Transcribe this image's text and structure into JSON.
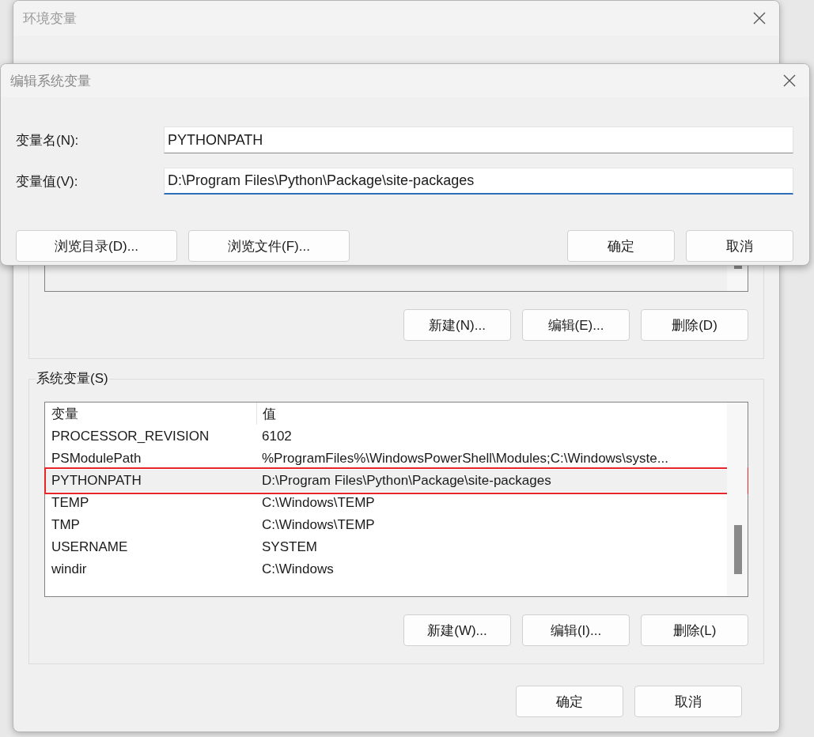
{
  "background_window": {
    "title": "环境变量",
    "user_variables": {
      "buttons": [
        "新建(N)...",
        "编辑(E)...",
        "删除(D)"
      ]
    },
    "system_variables": {
      "label": "系统变量(S)",
      "columns": [
        "变量",
        "值"
      ],
      "rows": [
        {
          "name": "PROCESSOR_REVISION",
          "value": "6102",
          "selected": false,
          "annotated": false
        },
        {
          "name": "PSModulePath",
          "value": "%ProgramFiles%\\WindowsPowerShell\\Modules;C:\\Windows\\syste...",
          "selected": false,
          "annotated": false
        },
        {
          "name": "PYTHONPATH",
          "value": "D:\\Program Files\\Python\\Package\\site-packages",
          "selected": true,
          "annotated": true
        },
        {
          "name": "TEMP",
          "value": "C:\\Windows\\TEMP",
          "selected": false,
          "annotated": false
        },
        {
          "name": "TMP",
          "value": "C:\\Windows\\TEMP",
          "selected": false,
          "annotated": false
        },
        {
          "name": "USERNAME",
          "value": "SYSTEM",
          "selected": false,
          "annotated": false
        },
        {
          "name": "windir",
          "value": "C:\\Windows",
          "selected": false,
          "annotated": false
        }
      ],
      "buttons": [
        "新建(W)...",
        "编辑(I)...",
        "删除(L)"
      ]
    },
    "buttons": [
      "确定",
      "取消"
    ]
  },
  "dialog": {
    "title": "编辑系统变量",
    "fields": [
      {
        "label": "变量名(N):",
        "value": "PYTHONPATH",
        "focused": false
      },
      {
        "label": "变量值(V):",
        "value": "D:\\Program Files\\Python\\Package\\site-packages",
        "focused": true
      }
    ],
    "left_buttons": [
      "浏览目录(D)...",
      "浏览文件(F)..."
    ],
    "right_buttons": [
      "确定",
      "取消"
    ]
  }
}
